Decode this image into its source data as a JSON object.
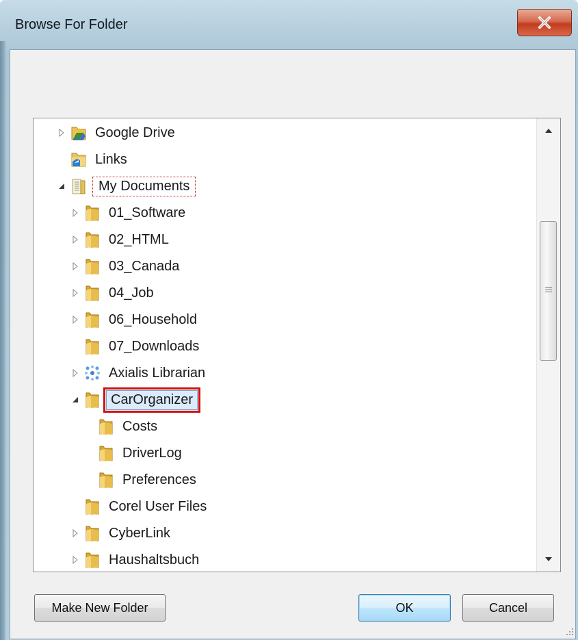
{
  "window": {
    "title": "Browse For Folder"
  },
  "tree": {
    "items": [
      {
        "label": "Google Drive",
        "toggle": "collapsed",
        "icon": "google-drive-icon"
      },
      {
        "label": "Links",
        "toggle": "none",
        "icon": "links-folder-icon"
      },
      {
        "label": "My Documents",
        "toggle": "expanded",
        "icon": "documents-library-icon"
      },
      {
        "label": "01_Software",
        "toggle": "collapsed",
        "icon": "folder-icon"
      },
      {
        "label": "02_HTML",
        "toggle": "collapsed",
        "icon": "folder-icon"
      },
      {
        "label": "03_Canada",
        "toggle": "collapsed",
        "icon": "folder-icon"
      },
      {
        "label": "04_Job",
        "toggle": "collapsed",
        "icon": "folder-icon"
      },
      {
        "label": "06_Household",
        "toggle": "collapsed",
        "icon": "folder-icon"
      },
      {
        "label": "07_Downloads",
        "toggle": "none",
        "icon": "folder-icon"
      },
      {
        "label": "Axialis Librarian",
        "toggle": "collapsed",
        "icon": "axialis-icon"
      },
      {
        "label": "CarOrganizer",
        "toggle": "expanded",
        "icon": "folder-icon"
      },
      {
        "label": "Costs",
        "toggle": "none",
        "icon": "folder-icon"
      },
      {
        "label": "DriverLog",
        "toggle": "none",
        "icon": "folder-icon"
      },
      {
        "label": "Preferences",
        "toggle": "none",
        "icon": "folder-icon"
      },
      {
        "label": "Corel User Files",
        "toggle": "none",
        "icon": "folder-icon"
      },
      {
        "label": "CyberLink",
        "toggle": "collapsed",
        "icon": "folder-icon"
      },
      {
        "label": "Haushaltsbuch",
        "toggle": "collapsed",
        "icon": "folder-icon"
      }
    ]
  },
  "buttons": {
    "make_new_folder": "Make New Folder",
    "ok": "OK",
    "cancel": "Cancel"
  },
  "colors": {
    "selection_outline": "#cc1111",
    "focus_dash": "#c04040",
    "selection_fill": "#dcebfc"
  }
}
